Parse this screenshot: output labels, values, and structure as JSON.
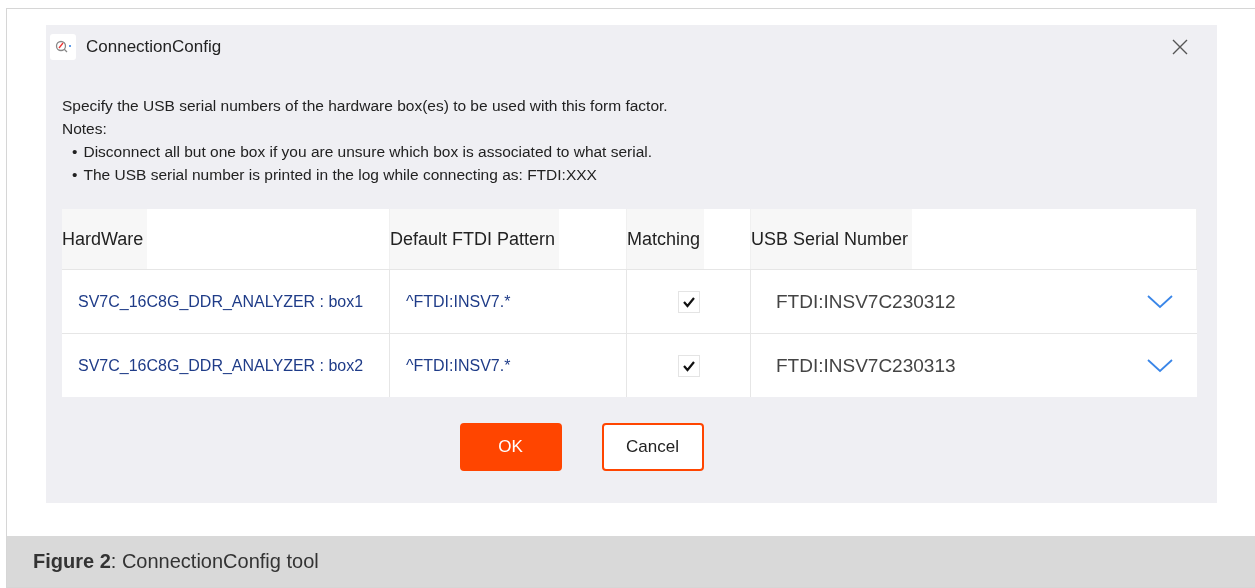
{
  "dialog": {
    "title": "ConnectionConfig",
    "intro": "Specify the USB serial numbers of the hardware box(es) to be used with this form factor.",
    "notes_label": "Notes:",
    "notes": [
      "Disconnect all but one box if you are unsure which box is associated to what serial.",
      "The USB serial number is printed in the log while connecting as: FTDI:XXX"
    ],
    "bullet": "•",
    "table": {
      "columns": [
        "HardWare",
        "Default FTDI Pattern",
        "Matching",
        "USB Serial Number"
      ],
      "rows": [
        {
          "hardware": "SV7C_16C8G_DDR_ANALYZER : box1",
          "pattern": "^FTDI:INSV7.*",
          "matching": true,
          "serial": "FTDI:INSV7C230312"
        },
        {
          "hardware": "SV7C_16C8G_DDR_ANALYZER : box2",
          "pattern": "^FTDI:INSV7.*",
          "matching": true,
          "serial": "FTDI:INSV7C230313"
        }
      ]
    },
    "buttons": [
      {
        "label": "OK",
        "kind": "primary"
      },
      {
        "label": "Cancel",
        "kind": "secondary"
      }
    ]
  },
  "caption": "**Figure 2**: ConnectionConfig tool"
}
